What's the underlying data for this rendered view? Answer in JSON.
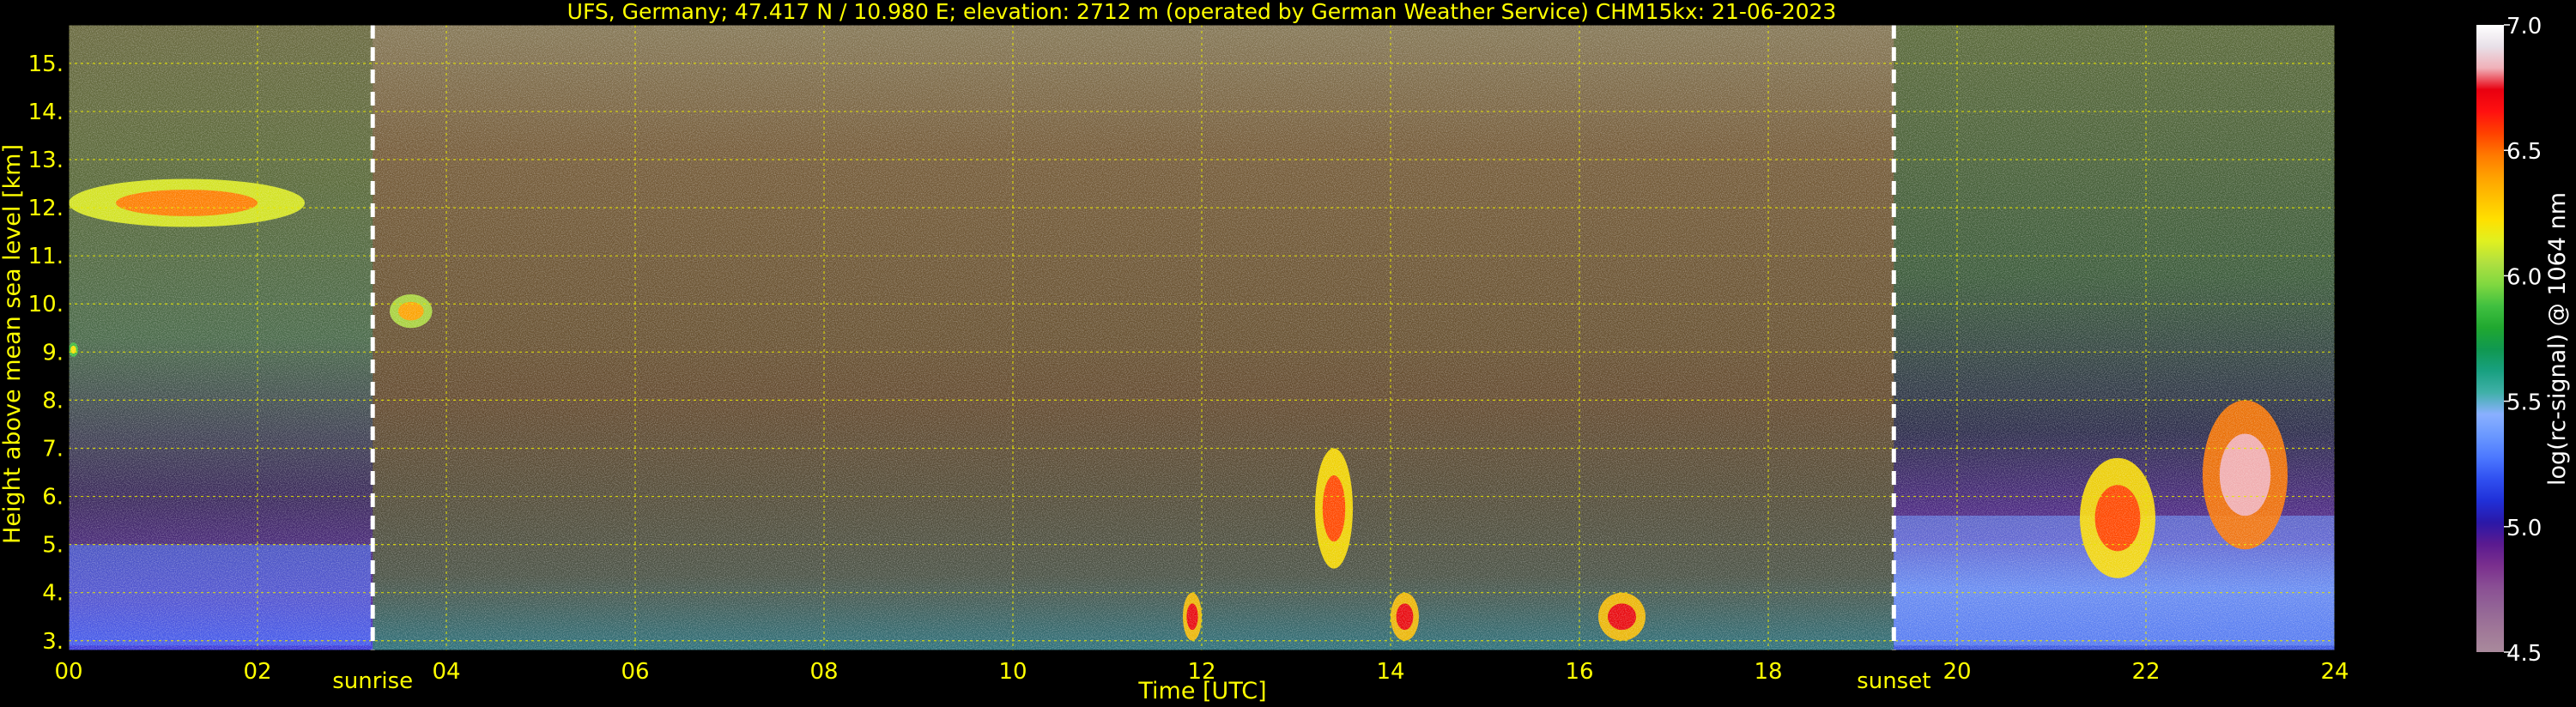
{
  "chart_data": {
    "type": "heatmap",
    "title": "UFS, Germany; 47.417 N / 10.980 E; elevation: 2712 m  (operated by German Weather Service)    CHM15kx: 21-06-2023",
    "xlabel": "Time [UTC]",
    "ylabel": "Height above mean sea level [km]",
    "xlim": [
      0,
      24
    ],
    "ylim": [
      2.8,
      15.8
    ],
    "x_ticks": [
      {
        "value": 0,
        "label": "00"
      },
      {
        "value": 2,
        "label": "02"
      },
      {
        "value": 4,
        "label": "04"
      },
      {
        "value": 6,
        "label": "06"
      },
      {
        "value": 8,
        "label": "08"
      },
      {
        "value": 10,
        "label": "10"
      },
      {
        "value": 12,
        "label": "12"
      },
      {
        "value": 14,
        "label": "14"
      },
      {
        "value": 16,
        "label": "16"
      },
      {
        "value": 18,
        "label": "18"
      },
      {
        "value": 20,
        "label": "20"
      },
      {
        "value": 22,
        "label": "22"
      },
      {
        "value": 24,
        "label": "24"
      }
    ],
    "y_ticks": [
      {
        "value": 3,
        "label": "3."
      },
      {
        "value": 4,
        "label": "4."
      },
      {
        "value": 5,
        "label": "5."
      },
      {
        "value": 6,
        "label": "6."
      },
      {
        "value": 7,
        "label": "7."
      },
      {
        "value": 8,
        "label": "8."
      },
      {
        "value": 9,
        "label": "9."
      },
      {
        "value": 10,
        "label": "10."
      },
      {
        "value": 11,
        "label": "11."
      },
      {
        "value": 12,
        "label": "12."
      },
      {
        "value": 13,
        "label": "13."
      },
      {
        "value": 14,
        "label": "14."
      },
      {
        "value": 15,
        "label": "15."
      }
    ],
    "grid": true,
    "markers": [
      {
        "x": 3.22,
        "label": "sunrise"
      },
      {
        "x": 19.33,
        "label": "sunset"
      }
    ],
    "colorbar": {
      "label": "log(rc-signal) @ 1064 nm",
      "min": 4.5,
      "max": 7.0,
      "ticks": [
        {
          "value": 4.5,
          "label": "4.5"
        },
        {
          "value": 5.0,
          "label": "5.0"
        },
        {
          "value": 5.5,
          "label": "5.5"
        },
        {
          "value": 6.0,
          "label": "6.0"
        },
        {
          "value": 6.5,
          "label": "6.5"
        },
        {
          "value": 7.0,
          "label": "7.0"
        }
      ],
      "colors": [
        "#a98a9c",
        "#a07898",
        "#936596",
        "#8a4f94",
        "#7a2f8e",
        "#5a1a90",
        "#2a18a8",
        "#2030d8",
        "#3050f0",
        "#4c78ff",
        "#6a98ff",
        "#8ab0ff",
        "#40b0a8",
        "#18a080",
        "#109850",
        "#20a830",
        "#40c040",
        "#80d840",
        "#b0e040",
        "#e0f020",
        "#ffe000",
        "#ffc000",
        "#ffa000",
        "#ff7800",
        "#ff4000",
        "#ff1010",
        "#e80010",
        "#f0b0b8",
        "#e8e0e8",
        "#ffffff"
      ]
    },
    "features": [
      {
        "name": "cirrus layer",
        "x": [
          0.0,
          2.5
        ],
        "y": [
          11.6,
          12.6
        ],
        "value": 6.5
      },
      {
        "name": "cloud",
        "x": [
          3.4,
          3.85
        ],
        "y": [
          9.5,
          10.2
        ],
        "value": 6.4
      },
      {
        "name": "cloud",
        "x": [
          0.0,
          0.1
        ],
        "y": [
          8.9,
          9.2
        ],
        "value": 6.2
      },
      {
        "name": "boundary layer",
        "x": [
          0.0,
          3.2
        ],
        "y": [
          2.9,
          5.0
        ],
        "value": 5.3
      },
      {
        "name": "boundary layer",
        "x": [
          19.33,
          24.0
        ],
        "y": [
          2.9,
          5.6
        ],
        "value": 5.4
      },
      {
        "name": "low cumulus",
        "x": [
          11.8,
          12.0
        ],
        "y": [
          3.0,
          4.0
        ],
        "value": 6.7
      },
      {
        "name": "low cumulus",
        "x": [
          14.0,
          14.3
        ],
        "y": [
          3.0,
          4.0
        ],
        "value": 6.7
      },
      {
        "name": "low cumulus",
        "x": [
          16.2,
          16.7
        ],
        "y": [
          3.0,
          4.0
        ],
        "value": 6.7
      },
      {
        "name": "convective cloud",
        "x": [
          13.2,
          13.6
        ],
        "y": [
          4.5,
          7.0
        ],
        "value": 6.6
      },
      {
        "name": "convective cloud",
        "x": [
          21.3,
          22.1
        ],
        "y": [
          4.3,
          6.8
        ],
        "value": 6.6
      },
      {
        "name": "convective cloud",
        "x": [
          22.6,
          23.5
        ],
        "y": [
          4.9,
          8.0
        ],
        "value": 6.8
      }
    ]
  }
}
